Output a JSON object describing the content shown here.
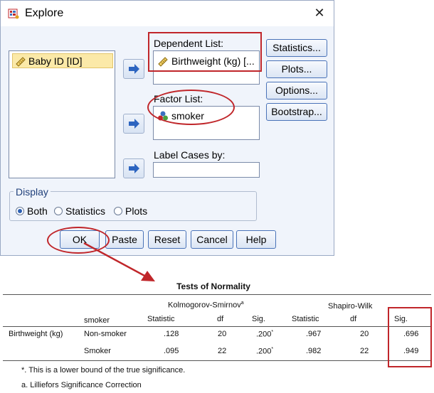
{
  "dialog": {
    "title": "Explore",
    "variables": [
      "Baby ID [ID]"
    ],
    "dependent_list": {
      "label": "Dependent List:",
      "items": [
        "Birthweight (kg) [..."
      ]
    },
    "factor_list": {
      "label": "Factor List:",
      "items": [
        "smoker"
      ]
    },
    "label_cases": {
      "label": "Label Cases by:",
      "value": ""
    },
    "side_buttons": {
      "statistics": "Statistics...",
      "plots": "Plots...",
      "options": "Options...",
      "bootstrap": "Bootstrap..."
    },
    "display": {
      "legend": "Display",
      "options": [
        "Both",
        "Statistics",
        "Plots"
      ],
      "selected": "Both"
    },
    "bottom_buttons": {
      "ok": "OK",
      "paste": "Paste",
      "reset": "Reset",
      "cancel": "Cancel",
      "help": "Help"
    }
  },
  "table": {
    "title": "Tests of Normality",
    "group1": "Kolmogorov-Smirnov",
    "group1_sup": "a",
    "group2": "Shapiro-Wilk",
    "row_header": "smoker",
    "columns": [
      "Statistic",
      "df",
      "Sig.",
      "Statistic",
      "df",
      "Sig."
    ],
    "variable": "Birthweight (kg)",
    "rows": [
      {
        "group": "Non-smoker",
        "ks_stat": ".128",
        "ks_df": "20",
        "ks_sig": ".200",
        "sw_stat": ".967",
        "sw_df": "20",
        "sw_sig": ".696"
      },
      {
        "group": "Smoker",
        "ks_stat": ".095",
        "ks_df": "22",
        "ks_sig": ".200",
        "sw_stat": ".982",
        "sw_df": "22",
        "sw_sig": ".949"
      }
    ],
    "sig_mark": "*",
    "footnotes": [
      "*. This is a lower bound of the true significance.",
      "a. Lilliefors Significance Correction"
    ]
  },
  "colors": {
    "annotation": "#c0262a",
    "selected_item": "#fbe9a8",
    "button_border": "#4a73b8"
  }
}
